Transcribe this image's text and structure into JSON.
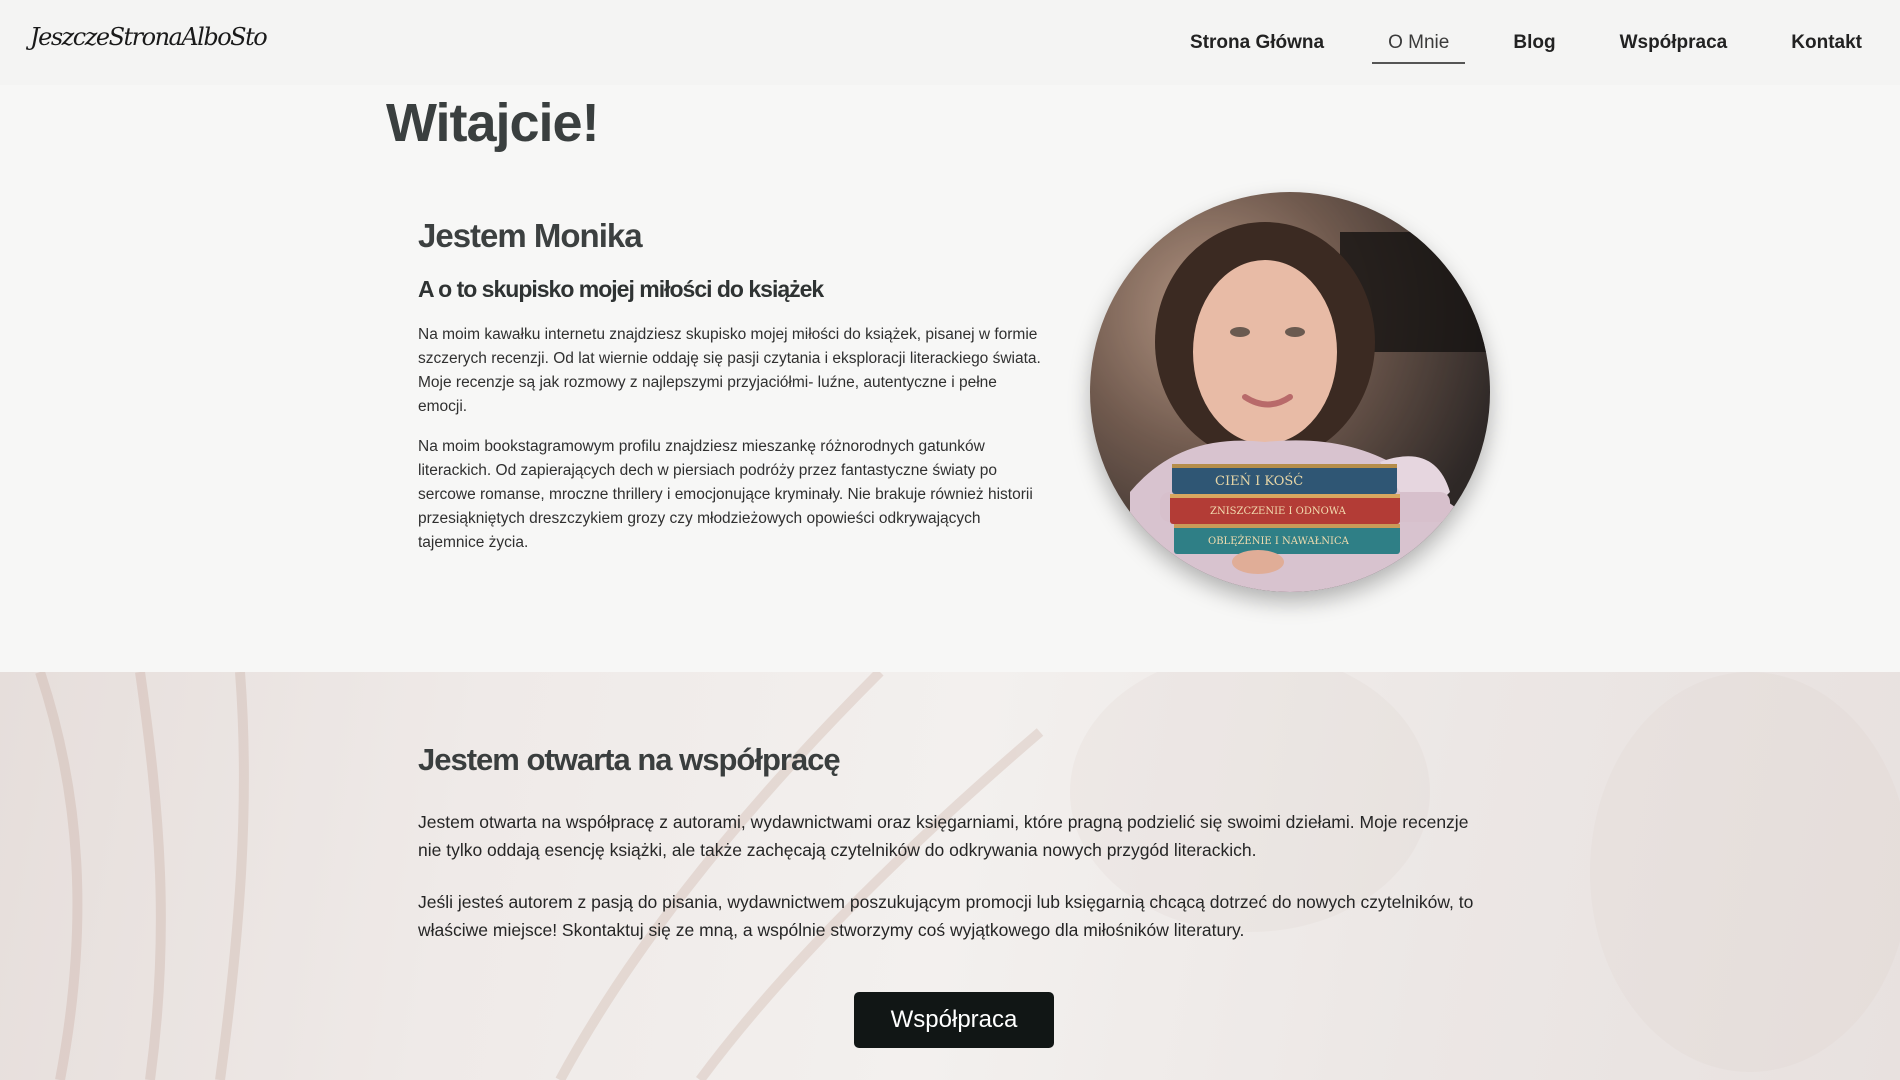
{
  "header": {
    "logo": "JeszczeStronaAlboSto",
    "nav": [
      {
        "label": "Strona Główna"
      },
      {
        "label": "O Mnie"
      },
      {
        "label": "Blog"
      },
      {
        "label": "Współpraca"
      },
      {
        "label": "Kontakt"
      }
    ],
    "active_nav": "O Mnie"
  },
  "hero": {
    "welcome": "Witajcie!"
  },
  "about": {
    "title": "Jestem Monika",
    "subtitle": "A o to skupisko mojej miłości do książek",
    "paragraphs": [
      "Na moim kawałku internetu znajdziesz skupisko mojej miłości do książek, pisanej w formie szczerych recenzji. Od lat wiernie oddaję się pasji czytania i eksploracji literackiego świata. Moje recenzje są jak rozmowy z najlepszymi przyjaciółmi- luźne, autentyczne i pełne emocji.",
      "Na moim bookstagramowym profilu znajdziesz mieszankę różnorodnych gatunków literackich. Od zapierających dech w piersiach podróży przez fantastyczne światy po sercowe romanse, mroczne thrillery i emocjonujące kryminały. Nie brakuje również historii przesiąkniętych dreszczykiem grozy czy młodzieżowych opowieści odkrywających tajemnice życia."
    ],
    "portrait": {
      "book_titles": [
        "CIEŃ I KOŚĆ",
        "ZNISZCZENIE I ODNOWA",
        "OBLĘŻENIE I NAWAŁNICA"
      ]
    }
  },
  "collab": {
    "title": "Jestem otwarta na współpracę",
    "paragraphs": [
      "Jestem otwarta na współpracę z autorami, wydawnictwami oraz księgarniami, które pragną podzielić się swoimi dziełami. Moje recenzje nie tylko oddają esencję książki, ale także zachęcają czytelników do odkrywania nowych przygód literackich.",
      "Jeśli jesteś autorem z pasją do pisania, wydawnictwem poszukującym promocji lub księgarnią chcącą dotrzeć do nowych czytelników, to właściwe miejsce! Skontaktuj się ze mną, a wspólnie stworzymy coś wyjątkowego dla miłośników literatury."
    ],
    "button_label": "Współpraca"
  },
  "colors": {
    "page_bg": "#f7f7f6",
    "header_bg": "#f4f4f3",
    "button_bg": "#111615",
    "button_text": "#ffffff",
    "heading": "#3a3f3f"
  }
}
